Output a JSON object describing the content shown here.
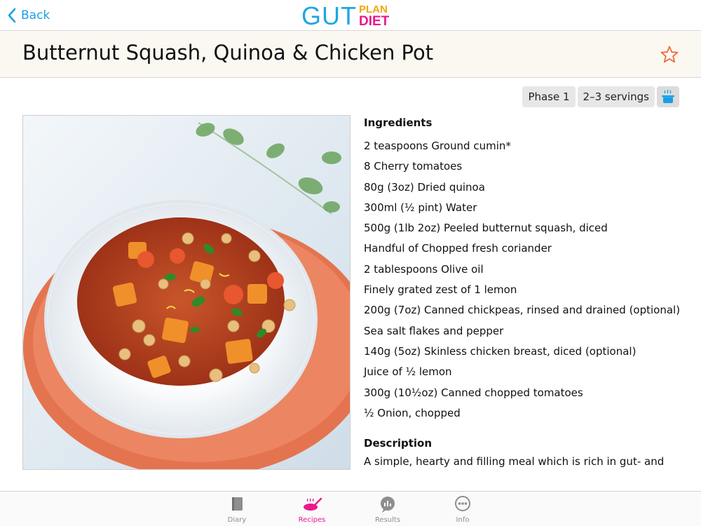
{
  "nav": {
    "back_label": "Back",
    "logo": {
      "main": "GUT",
      "top": "PLAN",
      "bottom": "DIET"
    }
  },
  "recipe": {
    "title": "Butternut Squash, Quinoa & Chicken Pot",
    "tags": [
      "Phase 1",
      "2–3 servings"
    ],
    "ingredients_heading": "Ingredients",
    "ingredients": [
      "2 teaspoons Ground cumin*",
      "8 Cherry tomatoes",
      "80g (3oz) Dried quinoa",
      "300ml (½ pint) Water",
      "500g (1lb 2oz) Peeled butternut squash, diced",
      "Handful of Chopped fresh coriander",
      "2 tablespoons Olive oil",
      "Finely grated zest of 1 lemon",
      "200g (7oz) Canned chickpeas, rinsed and drained (optional)",
      "Sea salt flakes and pepper",
      "140g (5oz) Skinless chicken breast, diced (optional)",
      "Juice of ½ lemon",
      "300g (10½oz) Canned chopped tomatoes",
      "½ Onion, chopped"
    ],
    "description_heading": "Description",
    "description": "A simple, hearty and filling meal which is rich in gut- and"
  },
  "tabs": [
    {
      "label": "Diary",
      "icon": "book-icon",
      "active": false
    },
    {
      "label": "Recipes",
      "icon": "pan-icon",
      "active": true
    },
    {
      "label": "Results",
      "icon": "chart-bubble-icon",
      "active": false
    },
    {
      "label": "Info",
      "icon": "more-bubble-icon",
      "active": false
    }
  ],
  "colors": {
    "accent": "#1a9fe6",
    "active_tab": "#e81a8c",
    "star": "#f06a3a",
    "logo_plan": "#f2a50a"
  }
}
